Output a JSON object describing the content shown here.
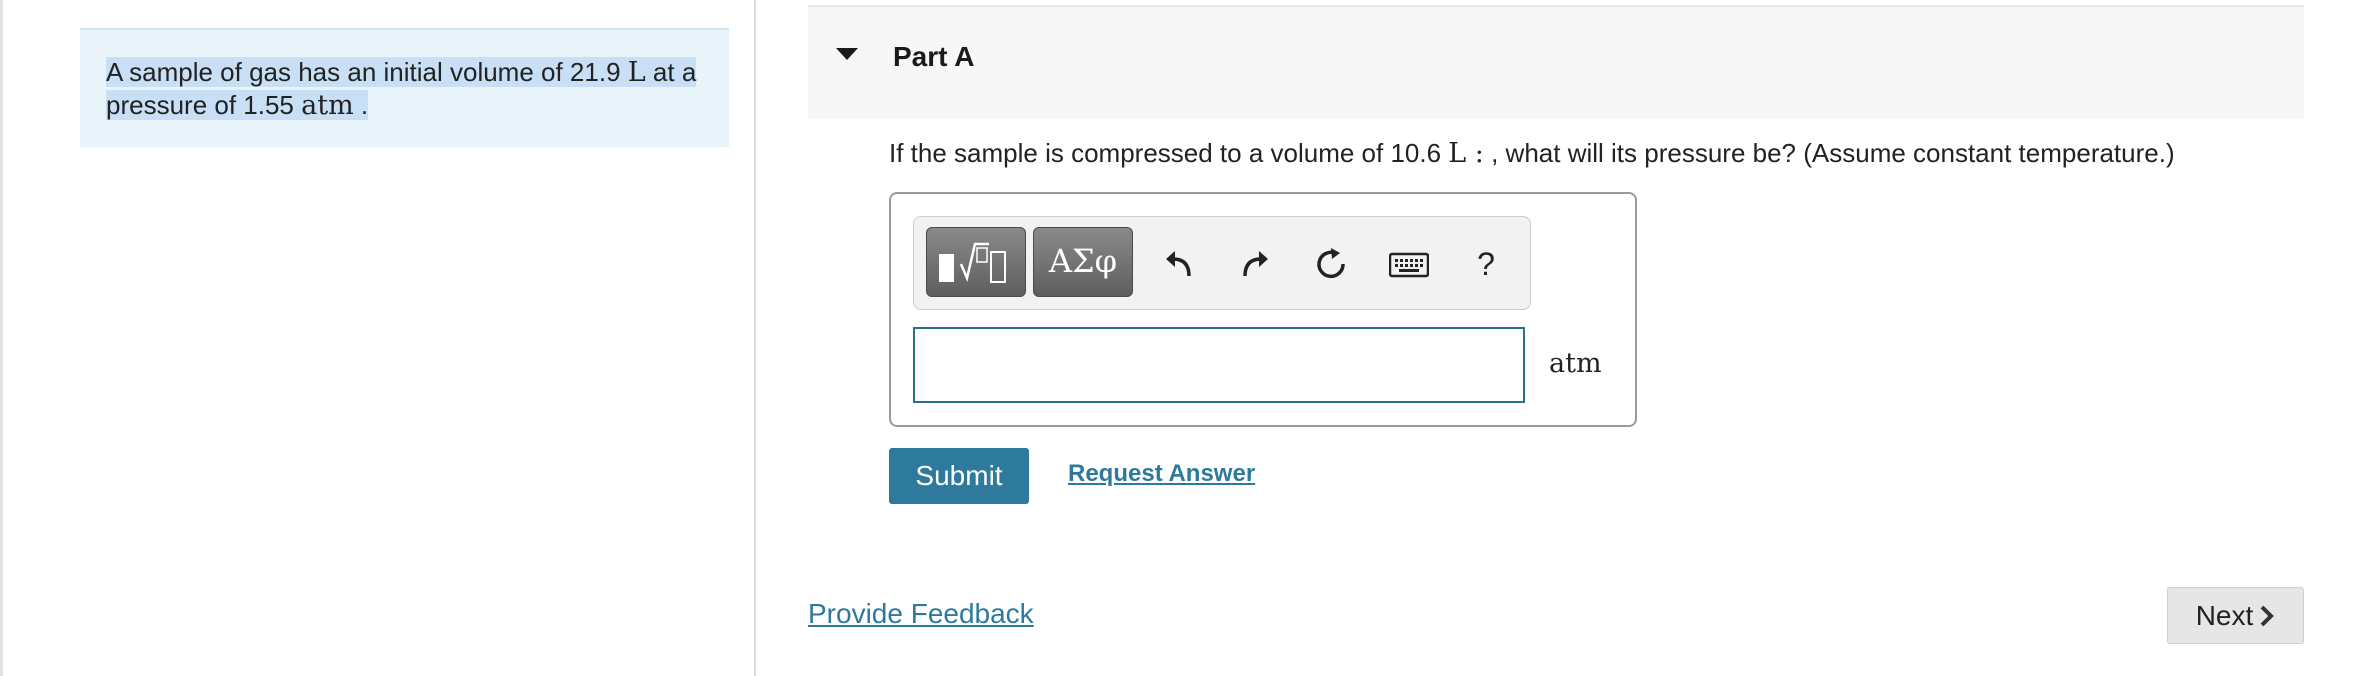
{
  "intro": {
    "text_before_volume": "A sample of gas has an initial volume of 21.9 ",
    "volume_unit": "L",
    "text_after_volume": " at a pressure of 1.55 ",
    "pressure_unit": "atm",
    "text_end": " ."
  },
  "part": {
    "title": "Part A",
    "question_before_unit": "If the sample is compressed to a volume of 10.6 ",
    "question_unit": "L :",
    "question_after_unit": " , what will its pressure be? (Assume constant temperature.)"
  },
  "toolbar": {
    "symbols_label": "ΑΣφ",
    "help_label": "?"
  },
  "answer": {
    "value": "",
    "unit": "atm"
  },
  "actions": {
    "submit_label": "Submit",
    "request_answer_label": "Request Answer",
    "provide_feedback_label": "Provide Feedback",
    "next_label": "Next"
  },
  "colors": {
    "accent": "#2e7a9c",
    "intro_bg": "#e8f4f9",
    "highlight": "#c8dff5"
  }
}
